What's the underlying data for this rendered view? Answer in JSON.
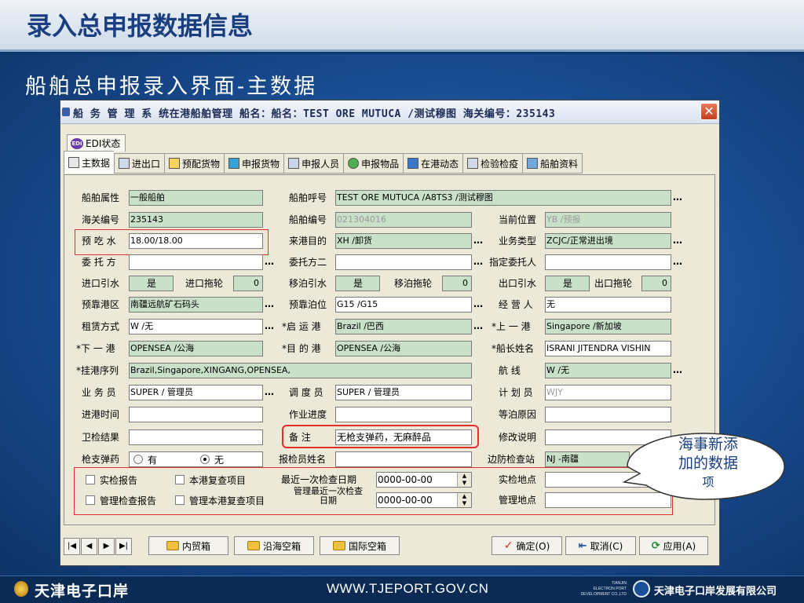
{
  "slide": {
    "title": "录入总申报数据信息",
    "subtitle": "船舶总申报录入界面-主数据"
  },
  "window": {
    "title": "船 务 管 理 系 统在港船舶管理  船名：船名：TEST ORE MUTUCA /测试穆图  海关编号：235143",
    "close": "✕"
  },
  "edi_tab": {
    "icon": "EDI",
    "label": "EDI状态"
  },
  "tabs": [
    {
      "label": "主数据",
      "icon": "main-data-icon"
    },
    {
      "label": "进出口",
      "icon": "import-export-icon"
    },
    {
      "label": "预配货物",
      "icon": "cargo-icon"
    },
    {
      "label": "申报货物",
      "icon": "declare-cargo-icon"
    },
    {
      "label": "申报人员",
      "icon": "declare-people-icon"
    },
    {
      "label": "申报物品",
      "icon": "declare-goods-icon"
    },
    {
      "label": "在港动态",
      "icon": "port-dynamics-icon"
    },
    {
      "label": "检验检疫",
      "icon": "inspection-icon"
    },
    {
      "label": "船舶资料",
      "icon": "ship-info-icon"
    }
  ],
  "form": {
    "ship_attr": {
      "label": "船舶属性",
      "value": "一般船舶"
    },
    "call_sign": {
      "label": "船舶呼号",
      "value": "TEST ORE MUTUCA /A8TS3      /测试穆图"
    },
    "customs_no": {
      "label": "海关编号",
      "value": "235143"
    },
    "ship_no": {
      "label": "船舶编号",
      "value": "021304016"
    },
    "position": {
      "label": "当前位置",
      "value": "YB    /预报"
    },
    "draft": {
      "label": "预 吃 水",
      "value": "18.00/18.00"
    },
    "purpose": {
      "label": "来港目的",
      "value": "XH   /卸货"
    },
    "biz_type": {
      "label": "业务类型",
      "value": "ZCJC/正常进出境"
    },
    "agent1": {
      "label": "委 托 方",
      "value": ""
    },
    "agent2": {
      "label": "委托方二",
      "value": ""
    },
    "appointed": {
      "label": "指定委托人",
      "value": ""
    },
    "in_pilot": {
      "label": "进口引水",
      "value": "是"
    },
    "in_tug": {
      "label": "进口拖轮",
      "value": "0"
    },
    "moor_pilot": {
      "label": "移泊引水",
      "value": "是"
    },
    "moor_tug": {
      "label": "移泊拖轮",
      "value": "0"
    },
    "out_pilot": {
      "label": "出口引水",
      "value": "是"
    },
    "out_tug": {
      "label": "出口拖轮",
      "value": "0"
    },
    "berth_area": {
      "label": "预靠港区",
      "value": "南疆远航矿石码头"
    },
    "berth": {
      "label": "预靠泊位",
      "value": "G15  /G15"
    },
    "operator": {
      "label": "经 营 人",
      "value": "无"
    },
    "lease": {
      "label": "租赁方式",
      "value": "W     /无"
    },
    "depart_port": {
      "label": "*启 运 港",
      "value": "Brazil /巴西"
    },
    "prev_port": {
      "label": "*上 一 港",
      "value": "Singapore /新加坡"
    },
    "next_port": {
      "label": "*下 一 港",
      "value": "OPENSEA /公海"
    },
    "dest_port": {
      "label": "*目 的 港",
      "value": "OPENSEA /公海"
    },
    "captain": {
      "label": "*船长姓名",
      "value": "ISRANI JITENDRA VISHIN"
    },
    "port_seq": {
      "label": "*挂港序列",
      "value": "Brazil,Singapore,XINGANG,OPENSEA,"
    },
    "route": {
      "label": "航    线",
      "value": "W     /无"
    },
    "salesman": {
      "label": "业 务 员",
      "value": "SUPER / 管理员"
    },
    "dispatcher": {
      "label": "调 度 员",
      "value": "SUPER / 管理员"
    },
    "planner": {
      "label": "计 划 员",
      "value": "WJY"
    },
    "entry_time": {
      "label": "进港时间",
      "value": ""
    },
    "progress": {
      "label": "作业进度",
      "value": ""
    },
    "wait_reason": {
      "label": "等泊原因",
      "value": ""
    },
    "health_result": {
      "label": "卫检结果",
      "value": ""
    },
    "remark": {
      "label": "备    注",
      "value": "无枪支弹药，无麻醉品"
    },
    "modify_note": {
      "label": "修改说明",
      "value": ""
    },
    "guns": {
      "label": "枪支弹药",
      "opt_yes": "有",
      "opt_no": "无"
    },
    "inspector": {
      "label": "报检员姓名",
      "value": ""
    },
    "border_station": {
      "label": "边防检查站",
      "value": "NJ  -南疆"
    },
    "check_report": "实检报告",
    "recheck_item": "本港复查项目",
    "recent_check_date": {
      "label": "最近一次检查日期",
      "value": "0000-00-00"
    },
    "check_place": {
      "label": "实检地点",
      "value": ""
    },
    "manage_report": "管理检查报告",
    "manage_recheck": "管理本港复查项目",
    "manage_recent_l1": "管理最近一次检查",
    "manage_recent_l2": "日期",
    "manage_date_value": "0000-00-00",
    "manage_place": {
      "label": "管理地点",
      "value": ""
    }
  },
  "toolbar": {
    "first": "|◀",
    "prev": "◀",
    "next": "▶",
    "last": "▶|",
    "domestic": "内贸箱",
    "coastal": "沿海空箱",
    "intl": "国际空箱",
    "ok": "确定(O)",
    "cancel": "取消(C)",
    "apply": "应用(A)"
  },
  "callout": {
    "line1": "海事新添",
    "line2": "加的数据",
    "line3": "项"
  },
  "footer": {
    "left": "天津电子口岸",
    "url": "WWW.TJEPORT.GOV.CN",
    "small1": "TIANJIN",
    "small2": "ELECTRON PORT",
    "small3": "DEVELOPMENT CO.,LTD",
    "right": "天津电子口岸发展有限公司"
  },
  "colors": {
    "accent": "#1a3f80",
    "field_green": "#c9e1c9",
    "highlight_red": "#e0302a"
  }
}
